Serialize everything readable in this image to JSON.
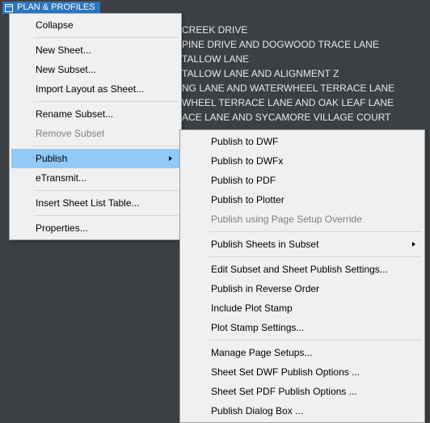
{
  "colors": {
    "accent": "#2b76c2",
    "menu_bg": "#f0f0f0",
    "hover": "#91c9f7"
  },
  "title_bar": {
    "label": "PLAN & PROFILES"
  },
  "bg_list": {
    "items": [
      "CREEK DRIVE",
      "PINE DRIVE AND DOGWOOD TRACE LANE",
      "TALLOW LANE",
      "TALLOW LANE AND ALIGNMENT Z",
      "NG LANE AND WATERWHEEL TERRACE LANE",
      "WHEEL TERRACE LANE AND OAK LEAF LANE",
      "ACE LANE AND SYCAMORE VILLAGE COURT"
    ]
  },
  "context_menu": {
    "items": {
      "collapse": "Collapse",
      "new_sheet": "New Sheet...",
      "new_subset": "New Subset...",
      "import_layout": "Import Layout as Sheet...",
      "rename_subset": "Rename Subset...",
      "remove_subset": "Remove Subset",
      "publish": "Publish",
      "etransmit": "eTransmit...",
      "insert_sheet_list": "Insert Sheet List Table...",
      "properties": "Properties..."
    }
  },
  "publish_submenu": {
    "items": {
      "dwf": "Publish to DWF",
      "dwfx": "Publish to DWFx",
      "pdf": "Publish to PDF",
      "plotter": "Publish to Plotter",
      "page_setup_override": "Publish using Page Setup Override",
      "sheets_in_subset": "Publish Sheets in Subset",
      "edit_subset_settings": "Edit Subset and Sheet Publish Settings...",
      "reverse_order": "Publish in Reverse Order",
      "include_plot_stamp": "Include Plot Stamp",
      "plot_stamp_settings": "Plot Stamp Settings...",
      "manage_page_setups": "Manage Page Setups...",
      "dwf_options": "Sheet Set DWF Publish Options ...",
      "pdf_options": "Sheet Set PDF Publish Options ...",
      "dialog_box": "Publish Dialog Box ..."
    }
  }
}
